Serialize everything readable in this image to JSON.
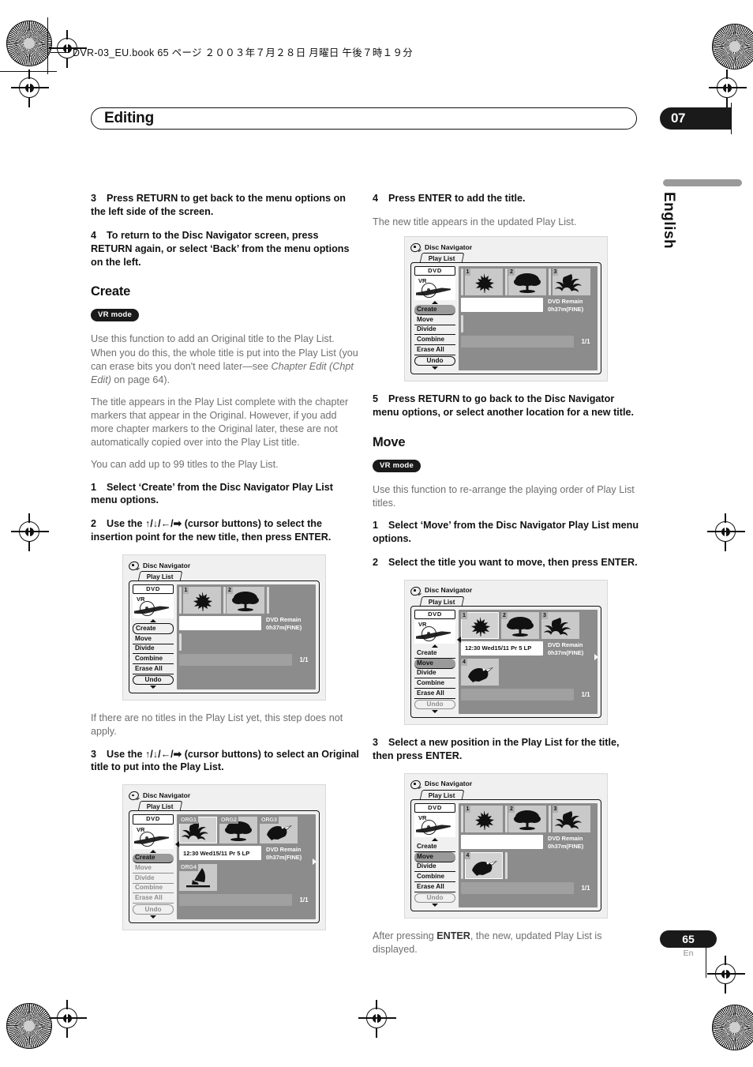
{
  "meta": {
    "runhead": "DVR-03_EU.book  65 ページ  ２００３年７月２８日  月曜日  午後７時１９分",
    "chapter_title": "Editing",
    "chapter_number": "07",
    "side_language": "English",
    "page_number": "65",
    "page_lang_code": "En"
  },
  "left_column": {
    "step3": {
      "num": "3",
      "text": "Press RETURN to get back to the menu options on the left side of the screen."
    },
    "step4": {
      "num": "4",
      "text": "To return to the Disc Navigator screen, press RETURN again, or select ‘Back’ from the menu options on the left."
    },
    "create_heading": "Create",
    "create_badge": "VR mode",
    "create_p1_a": "Use this function to add an Original title to the Play List. When you do this, the whole title is put into the Play List (you can erase bits you don't need later—see ",
    "create_p1_i": "Chapter Edit (Chpt Edit)",
    "create_p1_b": " on page 64).",
    "create_p2": "The title appears in the Play List complete with the chapter markers that appear in the Original. However, if you add more chapter markers to the Original later, these are not automatically copied over into the Play List title.",
    "create_p3": "You can add up to 99 titles to the Play List.",
    "c_step1": {
      "num": "1",
      "text": "Select ‘Create’ from the Disc Navigator Play List menu options."
    },
    "c_step2": {
      "num": "2",
      "text": "Use the ↑/↓/←/➡ (cursor buttons) to select the insertion point for the new title, then press ENTER."
    },
    "note_after_fig1": "If there are no titles in the Play List yet, this step does not apply.",
    "c_step3": {
      "num": "3",
      "text": "Use the ↑/↓/←/➡ (cursor buttons) to select an Original title to put into the Play List."
    }
  },
  "right_column": {
    "step4": {
      "num": "4",
      "text": "Press ENTER to add the title."
    },
    "step4_note": "The new title appears in the updated Play List.",
    "step5": {
      "num": "5",
      "text": "Press RETURN to go back to the Disc Navigator menu options, or select another location for a new title."
    },
    "move_heading": "Move",
    "move_badge": "VR mode",
    "move_p1": "Use this function to re-arrange the playing order of Play List titles.",
    "m_step1": {
      "num": "1",
      "text": "Select ‘Move’ from the Disc Navigator Play List menu options."
    },
    "m_step2": {
      "num": "2",
      "text": "Select the title you want to move, then press ENTER."
    },
    "m_step3": {
      "num": "3",
      "text": "Select a new position in the Play List for the title, then press ENTER."
    },
    "after_note_a": "After pressing ",
    "after_note_b": "ENTER",
    "after_note_c": ", the new, updated Play List is displayed."
  },
  "screen_common": {
    "header_label": "Disc Navigator",
    "tab_label": "Play List",
    "dvd_chip": "DVD",
    "vr_label": "VR",
    "menu": [
      "Create",
      "Move",
      "Divide",
      "Combine",
      "Erase All"
    ],
    "undo_label": "Undo",
    "remain_line1": "DVD Remain",
    "remain_line2": "0h37m(FINE)",
    "page_count": "1/1",
    "title_strip_text": "12:30 Wed15/11  Pr 5   LP"
  },
  "figures": {
    "fig_create_insertion": {
      "selected_menu": "Create",
      "menu_selection_style": "ring",
      "thumbs": [
        {
          "label": "1",
          "art": "maple-leaf",
          "selected": false
        },
        {
          "label": "2",
          "art": "tree",
          "selected": false
        }
      ],
      "title_strip": "",
      "has_caret_left": false,
      "has_caret_right": false
    },
    "fig_create_original": {
      "selected_menu": "Create",
      "menu_selection_style": "filled",
      "thumbs": [
        {
          "label": "ORG1",
          "art": "lily",
          "selected": true
        },
        {
          "label": "ORG2",
          "art": "tree",
          "selected": false
        },
        {
          "label": "ORG3",
          "art": "toucan",
          "selected": false
        }
      ],
      "thumbs_row2": [
        {
          "label": "ORG4",
          "art": "windsurfer",
          "selected": false
        }
      ],
      "title_strip": "12:30 Wed15/11  Pr 5   LP",
      "has_caret_left": true,
      "has_caret_right": true,
      "dim_menu": true
    },
    "fig_added_title": {
      "selected_menu": "Create",
      "menu_selection_style": "filled",
      "thumbs": [
        {
          "label": "1",
          "art": "maple-leaf",
          "selected": false
        },
        {
          "label": "2",
          "art": "tree",
          "selected": false
        },
        {
          "label": "3",
          "art": "lily",
          "selected": false
        }
      ],
      "title_strip": "",
      "has_caret_left": false,
      "has_caret_right": false
    },
    "fig_move_select": {
      "selected_menu": "Move",
      "menu_selection_style": "filled",
      "thumbs": [
        {
          "label": "1",
          "art": "maple-leaf",
          "selected": true
        },
        {
          "label": "2",
          "art": "tree",
          "selected": false
        },
        {
          "label": "3",
          "art": "lily",
          "selected": false
        }
      ],
      "thumbs_row2": [
        {
          "label": "4",
          "art": "toucan",
          "selected": false
        }
      ],
      "title_strip": "12:30 Wed15/11  Pr 5   LP",
      "has_caret_left": true,
      "has_caret_right": true,
      "dim_undo": true
    },
    "fig_move_position": {
      "selected_menu": "Move",
      "menu_selection_style": "filled",
      "thumbs": [
        {
          "label": "1",
          "art": "maple-leaf",
          "selected": false
        },
        {
          "label": "2",
          "art": "tree",
          "selected": false
        },
        {
          "label": "3",
          "art": "lily",
          "selected": false
        }
      ],
      "thumbs_row2": [
        {
          "label": "4",
          "art": "toucan",
          "selected": true
        }
      ],
      "title_strip": "",
      "has_caret_left": false,
      "has_caret_right": false,
      "dim_undo": true
    }
  }
}
